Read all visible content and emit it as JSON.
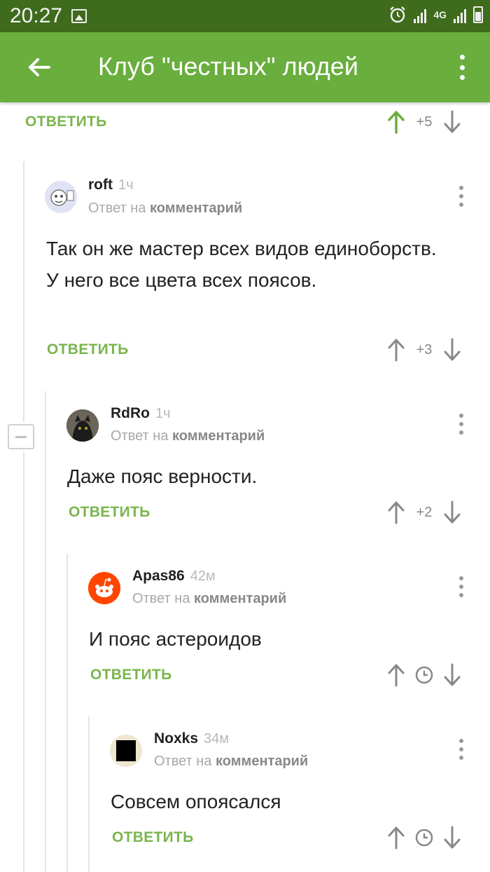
{
  "status_bar": {
    "time": "20:27",
    "network": "4G"
  },
  "app_bar": {
    "title": "Клуб \"честных\" людей"
  },
  "top": {
    "reply_label": "ОТВЕТИТЬ",
    "score": "+5"
  },
  "comments": [
    {
      "author": "roft",
      "ago": "1ч",
      "reply_prefix": "Ответ на",
      "reply_link": "комментарий",
      "text": "Так он же мастер всех видов единоборств. У него все цвета всех поясов.",
      "reply_label": "ОТВЕТИТЬ",
      "score": "+3"
    },
    {
      "author": "RdRo",
      "ago": "1ч",
      "reply_prefix": "Ответ на",
      "reply_link": "комментарий",
      "text": "Даже пояс верности.",
      "reply_label": "ОТВЕТИТЬ",
      "score": "+2"
    },
    {
      "author": "Apas86",
      "ago": "42м",
      "reply_prefix": "Ответ на",
      "reply_link": "комментарий",
      "text": "И пояс астероидов",
      "reply_label": "ОТВЕТИТЬ"
    },
    {
      "author": "Noxks",
      "ago": "34м",
      "reply_prefix": "Ответ на",
      "reply_link": "комментарий",
      "text": "Совсем опоясался",
      "reply_label": "ОТВЕТИТЬ"
    }
  ],
  "colors": {
    "accent": "#6aae3e",
    "status_bar": "#3f6b1c",
    "reply": "#7ab54d",
    "upvoted": "#6aae3e"
  }
}
